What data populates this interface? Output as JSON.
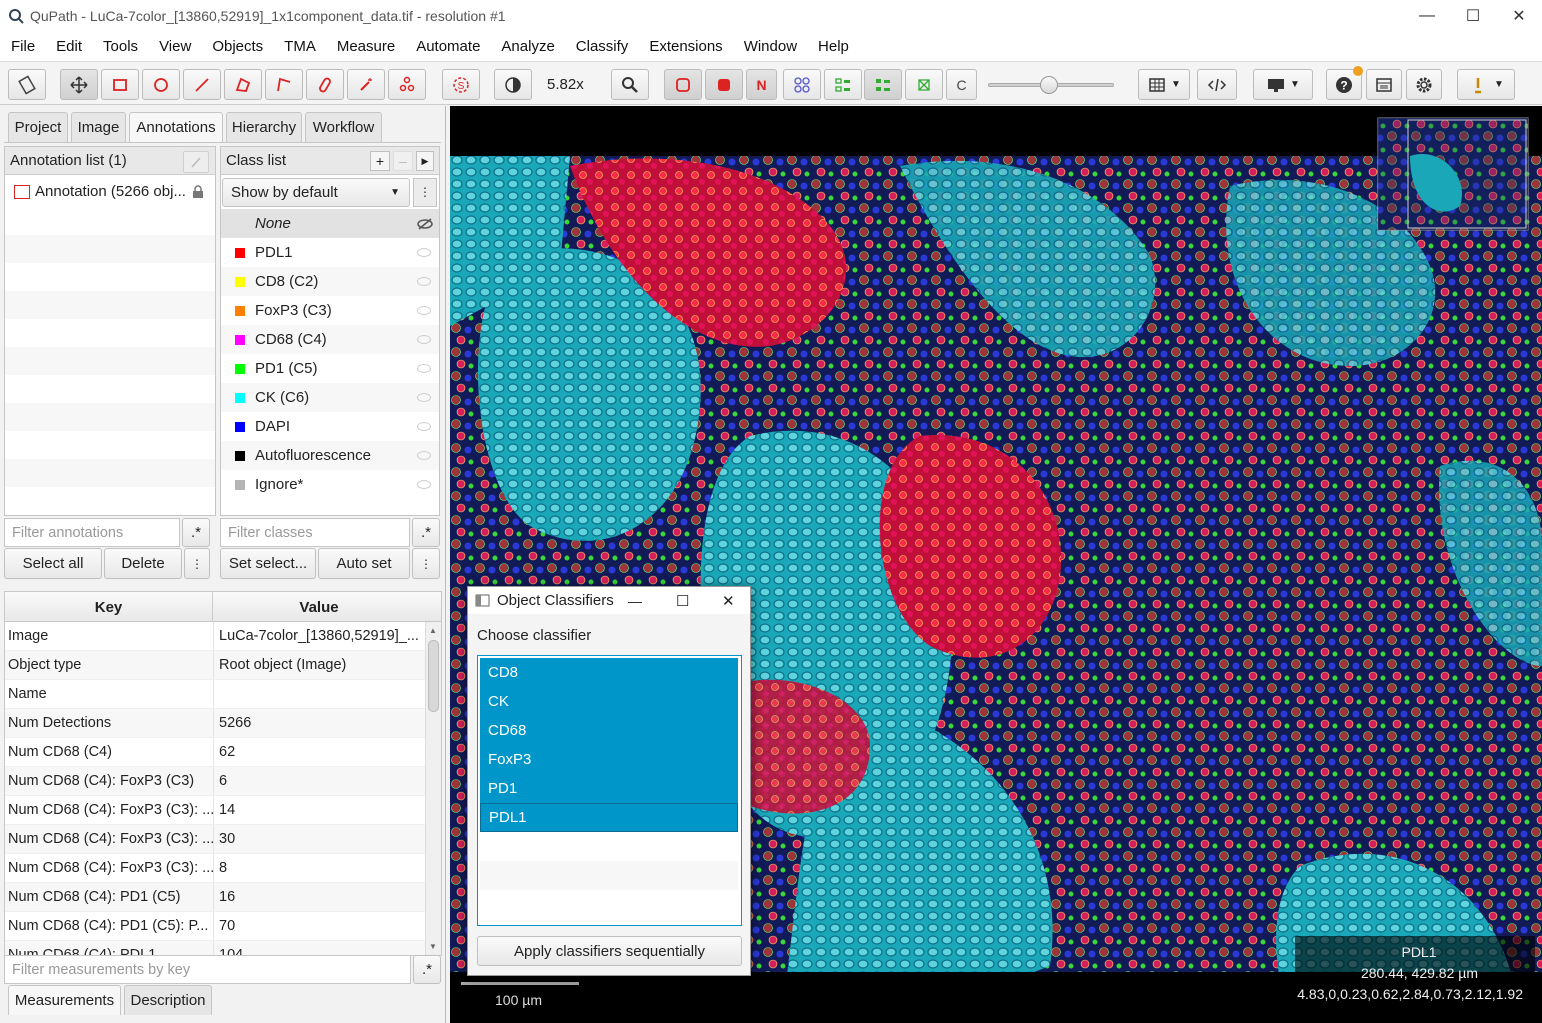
{
  "window": {
    "title": "QuPath - LuCa-7color_[13860,52919]_1x1component_data.tif - resolution #1"
  },
  "menu": [
    "File",
    "Edit",
    "Tools",
    "View",
    "Objects",
    "TMA",
    "Measure",
    "Automate",
    "Analyze",
    "Classify",
    "Extensions",
    "Window",
    "Help"
  ],
  "toolbar": {
    "zoom": "5.82x",
    "C": "C",
    "N": "N"
  },
  "tabs": [
    "Project",
    "Image",
    "Annotations",
    "Hierarchy",
    "Workflow"
  ],
  "annotations": {
    "header": "Annotation list (1)",
    "item": "Annotation (5266 obj...",
    "filter_placeholder": "Filter annotations",
    "select_all": "Select all",
    "delete": "Delete",
    "regex": ".*"
  },
  "classes": {
    "header": "Class list",
    "dropdown": "Show by default",
    "none": "None",
    "filter_placeholder": "Filter classes",
    "set_select": "Set select...",
    "auto_set": "Auto set",
    "items": [
      {
        "name": "PDL1",
        "color": "#ff0000"
      },
      {
        "name": "CD8 (C2)",
        "color": "#ffff00"
      },
      {
        "name": "FoxP3 (C3)",
        "color": "#ff8000"
      },
      {
        "name": "CD68 (C4)",
        "color": "#ff00ff"
      },
      {
        "name": "PD1 (C5)",
        "color": "#00ff00"
      },
      {
        "name": "CK (C6)",
        "color": "#00ffff"
      },
      {
        "name": "DAPI",
        "color": "#0000ff"
      },
      {
        "name": "Autofluorescence",
        "color": "#000000"
      },
      {
        "name": "Ignore*",
        "color": "#b4b4b4"
      }
    ]
  },
  "measurements": {
    "key_header": "Key",
    "value_header": "Value",
    "filter_placeholder": "Filter measurements by key",
    "rows": [
      {
        "k": "Image",
        "v": "LuCa-7color_[13860,52919]_..."
      },
      {
        "k": "Object type",
        "v": "Root object (Image)"
      },
      {
        "k": "Name",
        "v": ""
      },
      {
        "k": "Num Detections",
        "v": "5266"
      },
      {
        "k": "Num CD68 (C4)",
        "v": "62"
      },
      {
        "k": "Num CD68 (C4): FoxP3 (C3)",
        "v": "6"
      },
      {
        "k": "Num CD68 (C4): FoxP3 (C3): ...",
        "v": "14"
      },
      {
        "k": "Num CD68 (C4): FoxP3 (C3): ...",
        "v": "30"
      },
      {
        "k": "Num CD68 (C4): FoxP3 (C3): ...",
        "v": "8"
      },
      {
        "k": "Num CD68 (C4): PD1 (C5)",
        "v": "16"
      },
      {
        "k": "Num CD68 (C4): PD1 (C5): P...",
        "v": "70"
      },
      {
        "k": "Num CD68 (C4): PDL1",
        "v": "104"
      }
    ],
    "bottom_tabs": [
      "Measurements",
      "Description"
    ]
  },
  "viewer": {
    "scalebar": "100 µm",
    "cursor_class": "PDL1",
    "cursor_pos": "280.44, 429.82 µm",
    "cursor_values": "4.83,0,0.23,0.62,2.84,0.73,2.12,1.92"
  },
  "dialog": {
    "title": "Object Classifiers",
    "label": "Choose classifier",
    "items": [
      "CD8",
      "CK",
      "CD68",
      "FoxP3",
      "PD1",
      "PDL1"
    ],
    "button": "Apply classifiers sequentially"
  }
}
